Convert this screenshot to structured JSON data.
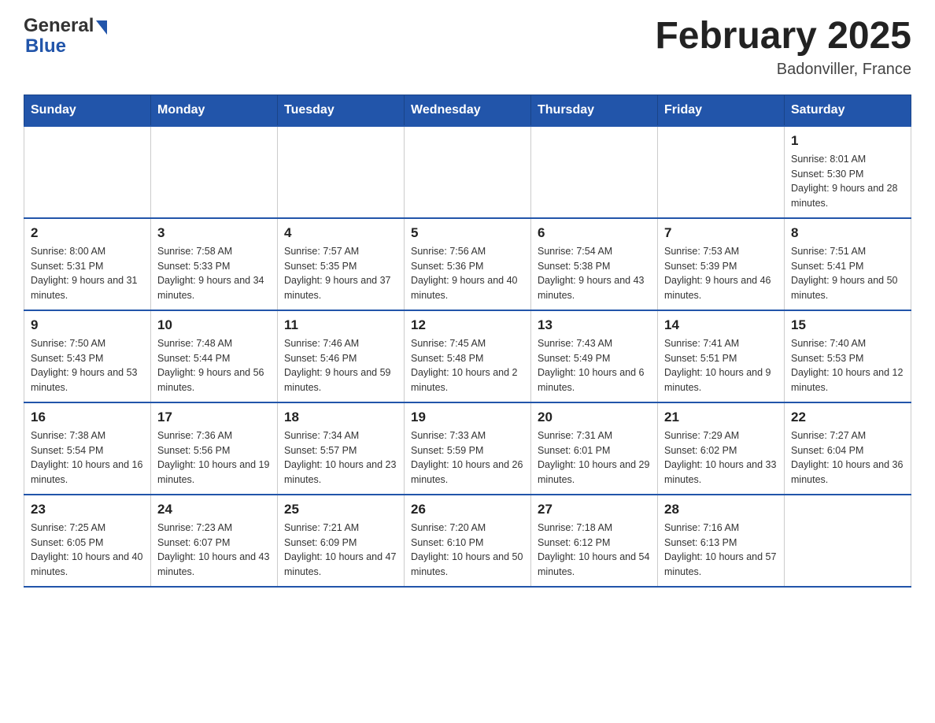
{
  "header": {
    "logo_general": "General",
    "logo_blue": "Blue",
    "month_title": "February 2025",
    "location": "Badonviller, France"
  },
  "days_of_week": [
    "Sunday",
    "Monday",
    "Tuesday",
    "Wednesday",
    "Thursday",
    "Friday",
    "Saturday"
  ],
  "weeks": [
    {
      "days": [
        {
          "num": "",
          "info": ""
        },
        {
          "num": "",
          "info": ""
        },
        {
          "num": "",
          "info": ""
        },
        {
          "num": "",
          "info": ""
        },
        {
          "num": "",
          "info": ""
        },
        {
          "num": "",
          "info": ""
        },
        {
          "num": "1",
          "info": "Sunrise: 8:01 AM\nSunset: 5:30 PM\nDaylight: 9 hours and 28 minutes."
        }
      ]
    },
    {
      "days": [
        {
          "num": "2",
          "info": "Sunrise: 8:00 AM\nSunset: 5:31 PM\nDaylight: 9 hours and 31 minutes."
        },
        {
          "num": "3",
          "info": "Sunrise: 7:58 AM\nSunset: 5:33 PM\nDaylight: 9 hours and 34 minutes."
        },
        {
          "num": "4",
          "info": "Sunrise: 7:57 AM\nSunset: 5:35 PM\nDaylight: 9 hours and 37 minutes."
        },
        {
          "num": "5",
          "info": "Sunrise: 7:56 AM\nSunset: 5:36 PM\nDaylight: 9 hours and 40 minutes."
        },
        {
          "num": "6",
          "info": "Sunrise: 7:54 AM\nSunset: 5:38 PM\nDaylight: 9 hours and 43 minutes."
        },
        {
          "num": "7",
          "info": "Sunrise: 7:53 AM\nSunset: 5:39 PM\nDaylight: 9 hours and 46 minutes."
        },
        {
          "num": "8",
          "info": "Sunrise: 7:51 AM\nSunset: 5:41 PM\nDaylight: 9 hours and 50 minutes."
        }
      ]
    },
    {
      "days": [
        {
          "num": "9",
          "info": "Sunrise: 7:50 AM\nSunset: 5:43 PM\nDaylight: 9 hours and 53 minutes."
        },
        {
          "num": "10",
          "info": "Sunrise: 7:48 AM\nSunset: 5:44 PM\nDaylight: 9 hours and 56 minutes."
        },
        {
          "num": "11",
          "info": "Sunrise: 7:46 AM\nSunset: 5:46 PM\nDaylight: 9 hours and 59 minutes."
        },
        {
          "num": "12",
          "info": "Sunrise: 7:45 AM\nSunset: 5:48 PM\nDaylight: 10 hours and 2 minutes."
        },
        {
          "num": "13",
          "info": "Sunrise: 7:43 AM\nSunset: 5:49 PM\nDaylight: 10 hours and 6 minutes."
        },
        {
          "num": "14",
          "info": "Sunrise: 7:41 AM\nSunset: 5:51 PM\nDaylight: 10 hours and 9 minutes."
        },
        {
          "num": "15",
          "info": "Sunrise: 7:40 AM\nSunset: 5:53 PM\nDaylight: 10 hours and 12 minutes."
        }
      ]
    },
    {
      "days": [
        {
          "num": "16",
          "info": "Sunrise: 7:38 AM\nSunset: 5:54 PM\nDaylight: 10 hours and 16 minutes."
        },
        {
          "num": "17",
          "info": "Sunrise: 7:36 AM\nSunset: 5:56 PM\nDaylight: 10 hours and 19 minutes."
        },
        {
          "num": "18",
          "info": "Sunrise: 7:34 AM\nSunset: 5:57 PM\nDaylight: 10 hours and 23 minutes."
        },
        {
          "num": "19",
          "info": "Sunrise: 7:33 AM\nSunset: 5:59 PM\nDaylight: 10 hours and 26 minutes."
        },
        {
          "num": "20",
          "info": "Sunrise: 7:31 AM\nSunset: 6:01 PM\nDaylight: 10 hours and 29 minutes."
        },
        {
          "num": "21",
          "info": "Sunrise: 7:29 AM\nSunset: 6:02 PM\nDaylight: 10 hours and 33 minutes."
        },
        {
          "num": "22",
          "info": "Sunrise: 7:27 AM\nSunset: 6:04 PM\nDaylight: 10 hours and 36 minutes."
        }
      ]
    },
    {
      "days": [
        {
          "num": "23",
          "info": "Sunrise: 7:25 AM\nSunset: 6:05 PM\nDaylight: 10 hours and 40 minutes."
        },
        {
          "num": "24",
          "info": "Sunrise: 7:23 AM\nSunset: 6:07 PM\nDaylight: 10 hours and 43 minutes."
        },
        {
          "num": "25",
          "info": "Sunrise: 7:21 AM\nSunset: 6:09 PM\nDaylight: 10 hours and 47 minutes."
        },
        {
          "num": "26",
          "info": "Sunrise: 7:20 AM\nSunset: 6:10 PM\nDaylight: 10 hours and 50 minutes."
        },
        {
          "num": "27",
          "info": "Sunrise: 7:18 AM\nSunset: 6:12 PM\nDaylight: 10 hours and 54 minutes."
        },
        {
          "num": "28",
          "info": "Sunrise: 7:16 AM\nSunset: 6:13 PM\nDaylight: 10 hours and 57 minutes."
        },
        {
          "num": "",
          "info": ""
        }
      ]
    }
  ]
}
